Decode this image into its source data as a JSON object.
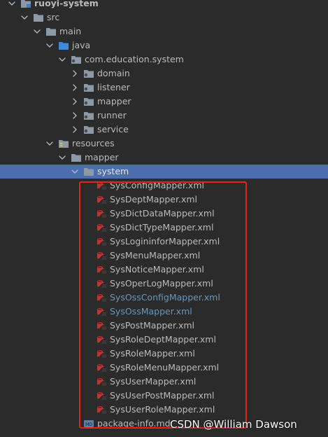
{
  "colors": {
    "background": "#2b2b2b",
    "text": "#bbbbbb",
    "selection": "#4b6eaf",
    "modified_text": "#6897bb",
    "folder_icon": "#8c9aa8",
    "highlight_border": "#e8221c"
  },
  "tree": [
    {
      "label": "ruoyi-system",
      "depth": 0,
      "icon": "module-folder-icon",
      "chevron": "down"
    },
    {
      "label": "src",
      "depth": 1,
      "icon": "folder-icon",
      "chevron": "down"
    },
    {
      "label": "main",
      "depth": 2,
      "icon": "folder-icon",
      "chevron": "down"
    },
    {
      "label": "java",
      "depth": 3,
      "icon": "source-root-folder-icon",
      "chevron": "down"
    },
    {
      "label": "com.education.system",
      "depth": 4,
      "icon": "package-icon",
      "chevron": "down"
    },
    {
      "label": "domain",
      "depth": 5,
      "icon": "package-icon",
      "chevron": "right"
    },
    {
      "label": "listener",
      "depth": 5,
      "icon": "package-icon",
      "chevron": "right"
    },
    {
      "label": "mapper",
      "depth": 5,
      "icon": "package-icon",
      "chevron": "right"
    },
    {
      "label": "runner",
      "depth": 5,
      "icon": "package-icon",
      "chevron": "right"
    },
    {
      "label": "service",
      "depth": 5,
      "icon": "package-icon",
      "chevron": "right"
    },
    {
      "label": "resources",
      "depth": 3,
      "icon": "resources-folder-icon",
      "chevron": "down"
    },
    {
      "label": "mapper",
      "depth": 4,
      "icon": "folder-icon",
      "chevron": "down"
    },
    {
      "label": "system",
      "depth": 5,
      "icon": "folder-icon",
      "chevron": "down",
      "selected": true
    },
    {
      "label": "SysConfigMapper.xml",
      "depth": 6,
      "icon": "mybatis-xml-icon"
    },
    {
      "label": "SysDeptMapper.xml",
      "depth": 6,
      "icon": "mybatis-xml-icon"
    },
    {
      "label": "SysDictDataMapper.xml",
      "depth": 6,
      "icon": "mybatis-xml-icon"
    },
    {
      "label": "SysDictTypeMapper.xml",
      "depth": 6,
      "icon": "mybatis-xml-icon"
    },
    {
      "label": "SysLogininforMapper.xml",
      "depth": 6,
      "icon": "mybatis-xml-icon"
    },
    {
      "label": "SysMenuMapper.xml",
      "depth": 6,
      "icon": "mybatis-xml-icon"
    },
    {
      "label": "SysNoticeMapper.xml",
      "depth": 6,
      "icon": "mybatis-xml-icon"
    },
    {
      "label": "SysOperLogMapper.xml",
      "depth": 6,
      "icon": "mybatis-xml-icon"
    },
    {
      "label": "SysOssConfigMapper.xml",
      "depth": 6,
      "icon": "mybatis-xml-icon",
      "modified": true
    },
    {
      "label": "SysOssMapper.xml",
      "depth": 6,
      "icon": "mybatis-xml-icon",
      "modified": true
    },
    {
      "label": "SysPostMapper.xml",
      "depth": 6,
      "icon": "mybatis-xml-icon"
    },
    {
      "label": "SysRoleDeptMapper.xml",
      "depth": 6,
      "icon": "mybatis-xml-icon"
    },
    {
      "label": "SysRoleMapper.xml",
      "depth": 6,
      "icon": "mybatis-xml-icon"
    },
    {
      "label": "SysRoleMenuMapper.xml",
      "depth": 6,
      "icon": "mybatis-xml-icon"
    },
    {
      "label": "SysUserMapper.xml",
      "depth": 6,
      "icon": "mybatis-xml-icon"
    },
    {
      "label": "SysUserPostMapper.xml",
      "depth": 6,
      "icon": "mybatis-xml-icon"
    },
    {
      "label": "SysUserRoleMapper.xml",
      "depth": 6,
      "icon": "mybatis-xml-icon"
    },
    {
      "label": "package-info.md",
      "depth": 5,
      "icon": "markdown-file-icon"
    }
  ],
  "watermark": "CSDN @William Dawson"
}
